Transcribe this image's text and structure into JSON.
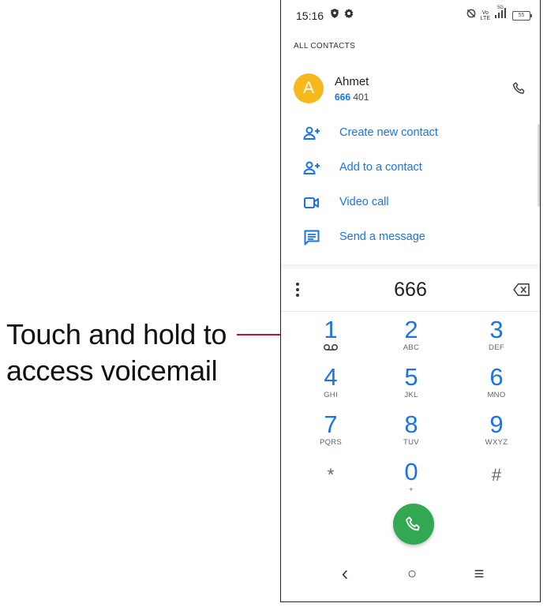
{
  "annotation": {
    "line1": "Touch and hold to",
    "line2": "access voicemail"
  },
  "colors": {
    "accent": "#1a73e8",
    "avatar": "#f6b81d",
    "call_button": "#33a852",
    "leader_line": "#c8102e"
  },
  "status_bar": {
    "time": "15:16",
    "left_icons": [
      "shield-icon",
      "gear-icon"
    ],
    "right_icons": [
      "sync-off-icon",
      "volte-icon",
      "signal-icon",
      "battery-icon"
    ],
    "volte_label_top": "Vo",
    "volte_label_bottom": "LTE",
    "network_label": "5G",
    "battery_level": "55"
  },
  "contacts": {
    "section_header": "ALL CONTACTS",
    "items": [
      {
        "avatar_letter": "A",
        "name": "Ahmet",
        "number_match": "666",
        "number_rest": " 401"
      }
    ]
  },
  "actions": [
    {
      "label": "Create new contact",
      "icon": "person-add-icon"
    },
    {
      "label": "Add to a contact",
      "icon": "person-add-icon"
    },
    {
      "label": "Video call",
      "icon": "video-call-icon"
    },
    {
      "label": "Send a message",
      "icon": "message-icon"
    }
  ],
  "dialpad": {
    "input_value": "666",
    "keys": [
      {
        "digit": "1",
        "letters": "",
        "icon": "voicemail-icon"
      },
      {
        "digit": "2",
        "letters": "ABC"
      },
      {
        "digit": "3",
        "letters": "DEF"
      },
      {
        "digit": "4",
        "letters": "GHI"
      },
      {
        "digit": "5",
        "letters": "JKL"
      },
      {
        "digit": "6",
        "letters": "MNO"
      },
      {
        "digit": "7",
        "letters": "PQRS"
      },
      {
        "digit": "8",
        "letters": "TUV"
      },
      {
        "digit": "9",
        "letters": "WXYZ"
      },
      {
        "digit": "*",
        "letters": ""
      },
      {
        "digit": "0",
        "letters": "+"
      },
      {
        "digit": "#",
        "letters": ""
      }
    ]
  },
  "navbar": {
    "back_glyph": "‹",
    "home_glyph": "○",
    "recents_glyph": "≡"
  }
}
